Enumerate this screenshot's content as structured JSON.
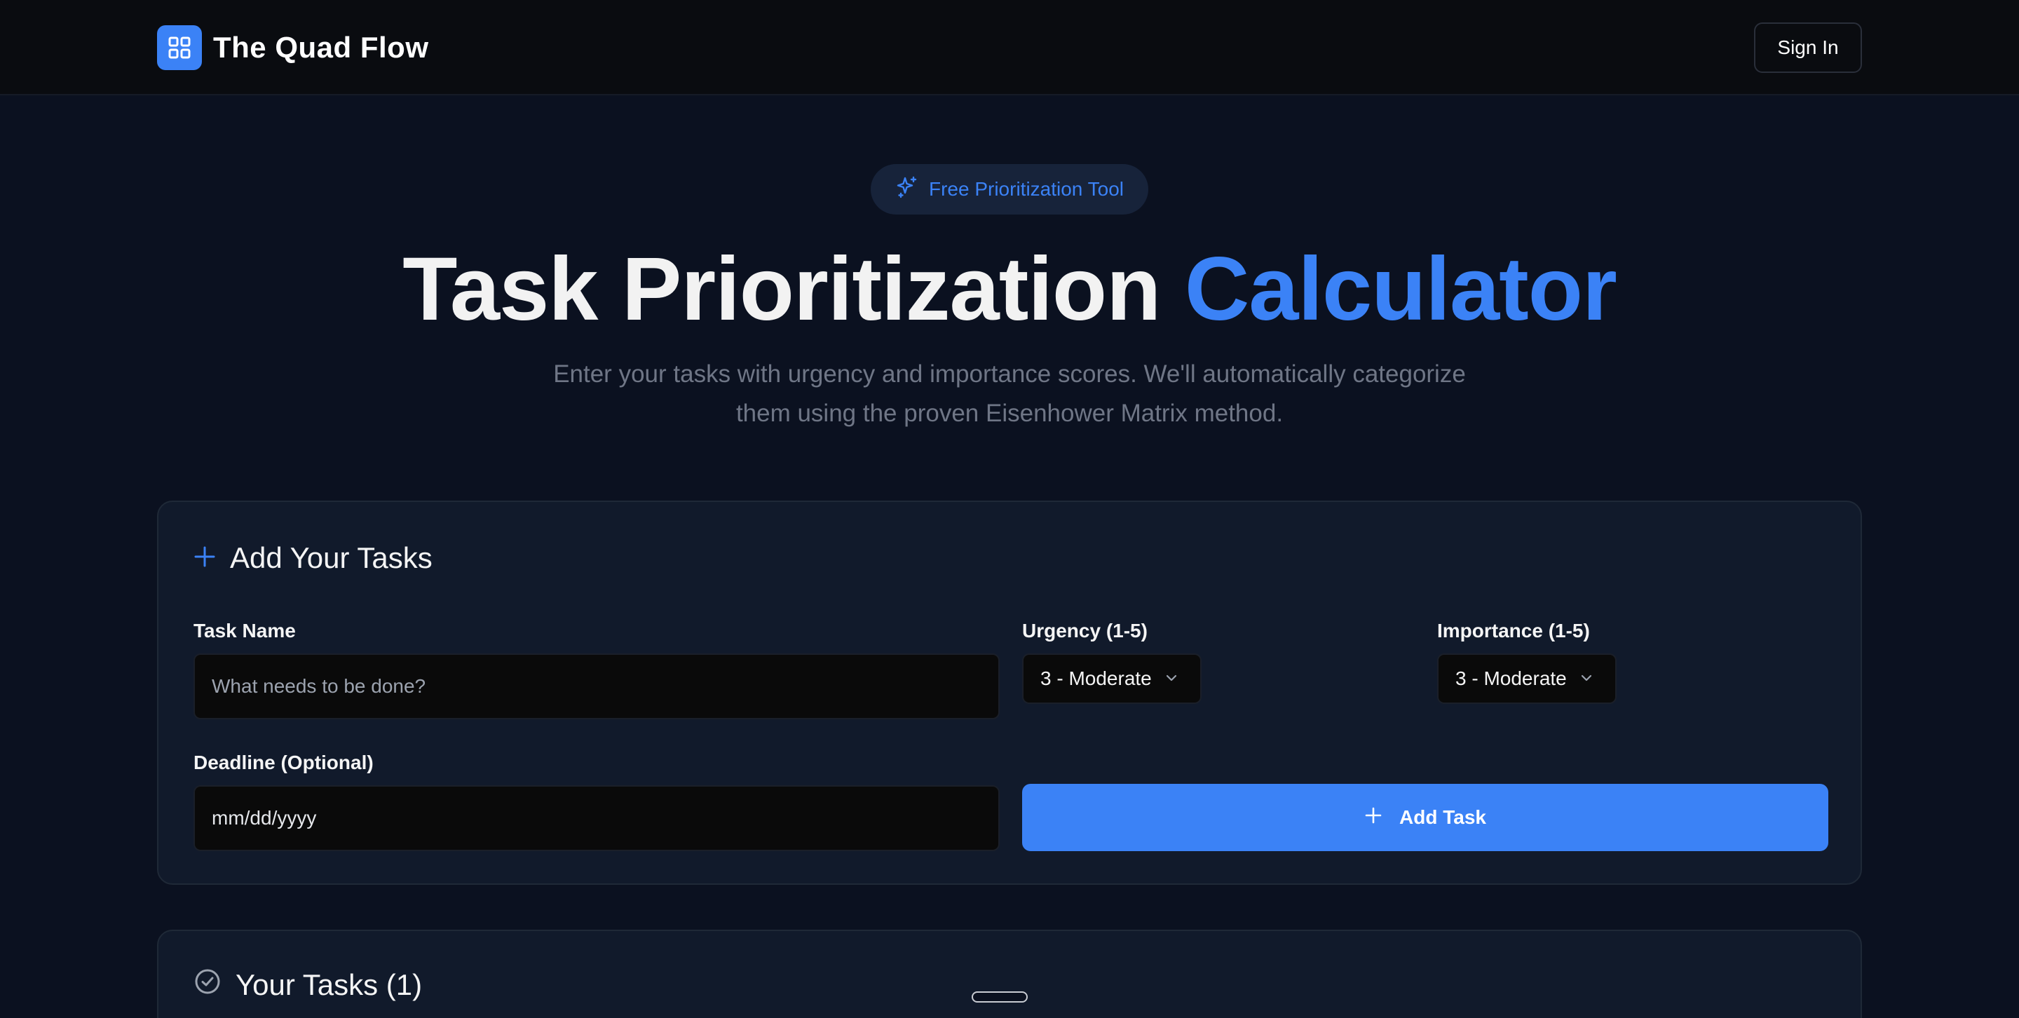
{
  "header": {
    "brand": "The Quad Flow",
    "sign_in": "Sign In"
  },
  "hero": {
    "badge": "Free Prioritization Tool",
    "title_main": "Task Prioritization",
    "title_accent": "Calculator",
    "subtitle_line1": "Enter your tasks with urgency and importance scores. We'll automatically categorize",
    "subtitle_line2": "them using the proven Eisenhower Matrix method."
  },
  "add_card": {
    "title": "Add Your Tasks",
    "task_name_label": "Task Name",
    "task_name_placeholder": "What needs to be done?",
    "urgency_label": "Urgency (1-5)",
    "urgency_value": "3 - Moderate",
    "importance_label": "Importance (1-5)",
    "importance_value": "3 - Moderate",
    "deadline_label": "Deadline (Optional)",
    "deadline_placeholder": "mm/dd/yyyy",
    "add_button": "Add Task"
  },
  "tasks_card": {
    "title": "Your Tasks (1)"
  },
  "colors": {
    "accent": "#3b82f6",
    "background": "#0b1120",
    "card": "#111a2b",
    "header": "#0a0c10"
  },
  "icons": {
    "logo": "grid-icon",
    "badge": "sparkles-icon",
    "add_title": "plus-icon",
    "add_button": "plus-icon",
    "tasks_title": "check-circle-icon",
    "select": "chevron-down-icon"
  }
}
